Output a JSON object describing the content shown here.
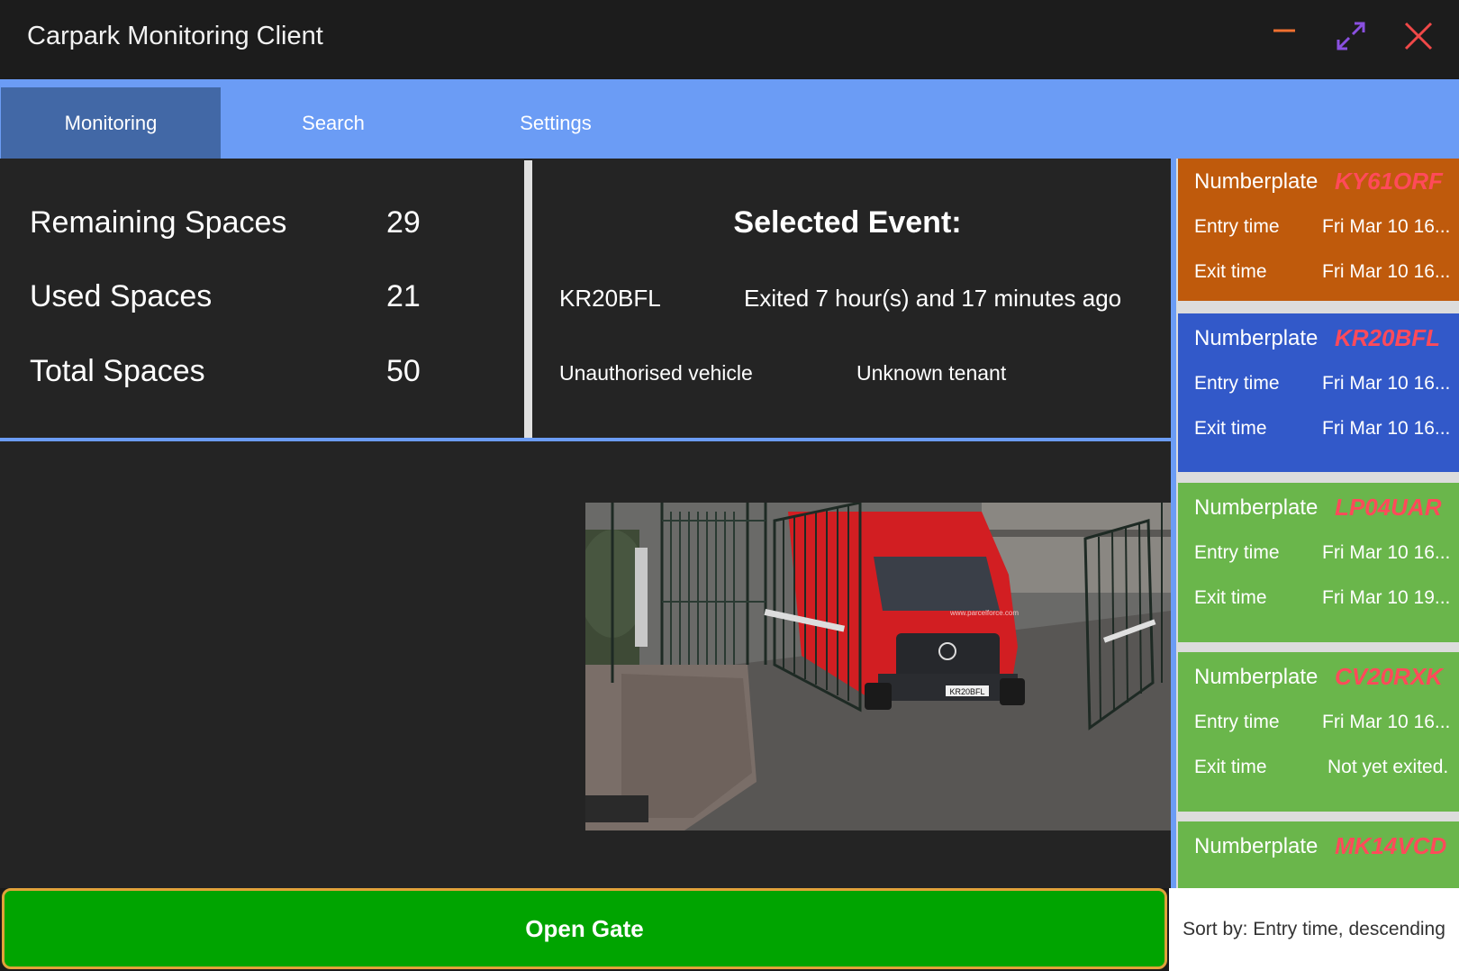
{
  "window": {
    "title": "Carpark Monitoring Client",
    "controls": [
      "minimize-icon",
      "maximize-icon",
      "close-icon"
    ],
    "colors": {
      "minimize": "#f07030",
      "maximize": "#8a50e0",
      "close": "#f04848"
    }
  },
  "tabs": [
    {
      "label": "Monitoring",
      "active": true
    },
    {
      "label": "Search",
      "active": false
    },
    {
      "label": "Settings",
      "active": false
    }
  ],
  "stats": {
    "remaining": {
      "label": "Remaining Spaces",
      "value": "29"
    },
    "used": {
      "label": "Used Spaces",
      "value": "21"
    },
    "total": {
      "label": "Total Spaces",
      "value": "50"
    }
  },
  "selected_event": {
    "heading": "Selected Event:",
    "plate": "KR20BFL",
    "status": "Exited 7 hour(s) and 17 minutes ago",
    "authorisation": "Unauthorised vehicle",
    "tenant": "Unknown tenant"
  },
  "camera": {
    "plate_text": "KR20BFL",
    "van_text": "www.parcelforce.com"
  },
  "events": [
    {
      "np_label": "Numberplate",
      "plate": "KY61ORF",
      "entry_label": "Entry time",
      "entry": "Fri Mar 10 16...",
      "exit_label": "Exit time",
      "exit": "Fri Mar 10 16...",
      "color": "#bf5a0c"
    },
    {
      "np_label": "Numberplate",
      "plate": "KR20BFL",
      "entry_label": "Entry time",
      "entry": "Fri Mar 10 16...",
      "exit_label": "Exit time",
      "exit": "Fri Mar 10 16...",
      "color": "#3259c9"
    },
    {
      "np_label": "Numberplate",
      "plate": "LP04UAR",
      "entry_label": "Entry time",
      "entry": "Fri Mar 10 16...",
      "exit_label": "Exit time",
      "exit": "Fri Mar 10 19...",
      "color": "#6ab64b"
    },
    {
      "np_label": "Numberplate",
      "plate": "CV20RXK",
      "entry_label": "Entry time",
      "entry": "Fri Mar 10 16...",
      "exit_label": "Exit time",
      "exit": "Not yet exited.",
      "color": "#6ab64b"
    },
    {
      "np_label": "Numberplate",
      "plate": "MK14VCD",
      "color": "#6ab64b"
    }
  ],
  "actions": {
    "open_gate": "Open Gate",
    "sort": "Sort by: Entry time, descending"
  }
}
